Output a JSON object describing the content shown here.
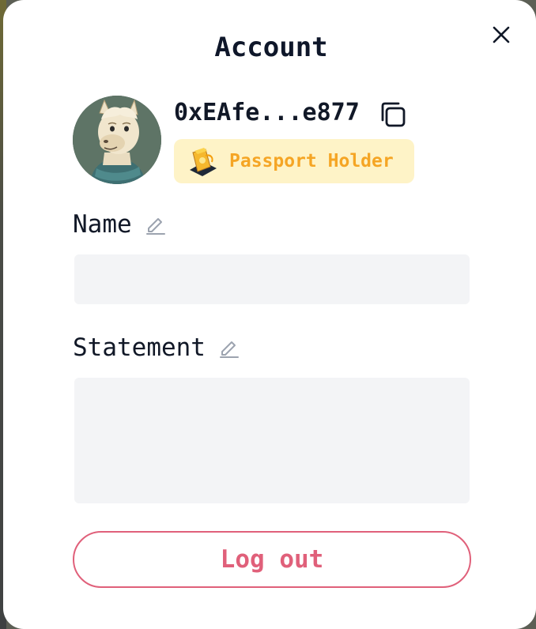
{
  "modal": {
    "title": "Account",
    "close_icon": "close-icon"
  },
  "profile": {
    "avatar_icon": "llama-avatar",
    "address": "0xEAfe...e877",
    "copy_icon": "copy-icon",
    "badge": {
      "icon": "passport-icon",
      "label": "Passport Holder"
    }
  },
  "form": {
    "name": {
      "label": "Name",
      "edit_icon": "pencil-icon",
      "value": "",
      "placeholder": ""
    },
    "statement": {
      "label": "Statement",
      "edit_icon": "pencil-icon",
      "value": "",
      "placeholder": ""
    }
  },
  "actions": {
    "logout_label": "Log out"
  },
  "colors": {
    "badge_bg": "#fef3c7",
    "badge_text": "#f5a524",
    "input_bg": "#f3f4f6",
    "logout": "#e0607a",
    "text": "#111827"
  }
}
